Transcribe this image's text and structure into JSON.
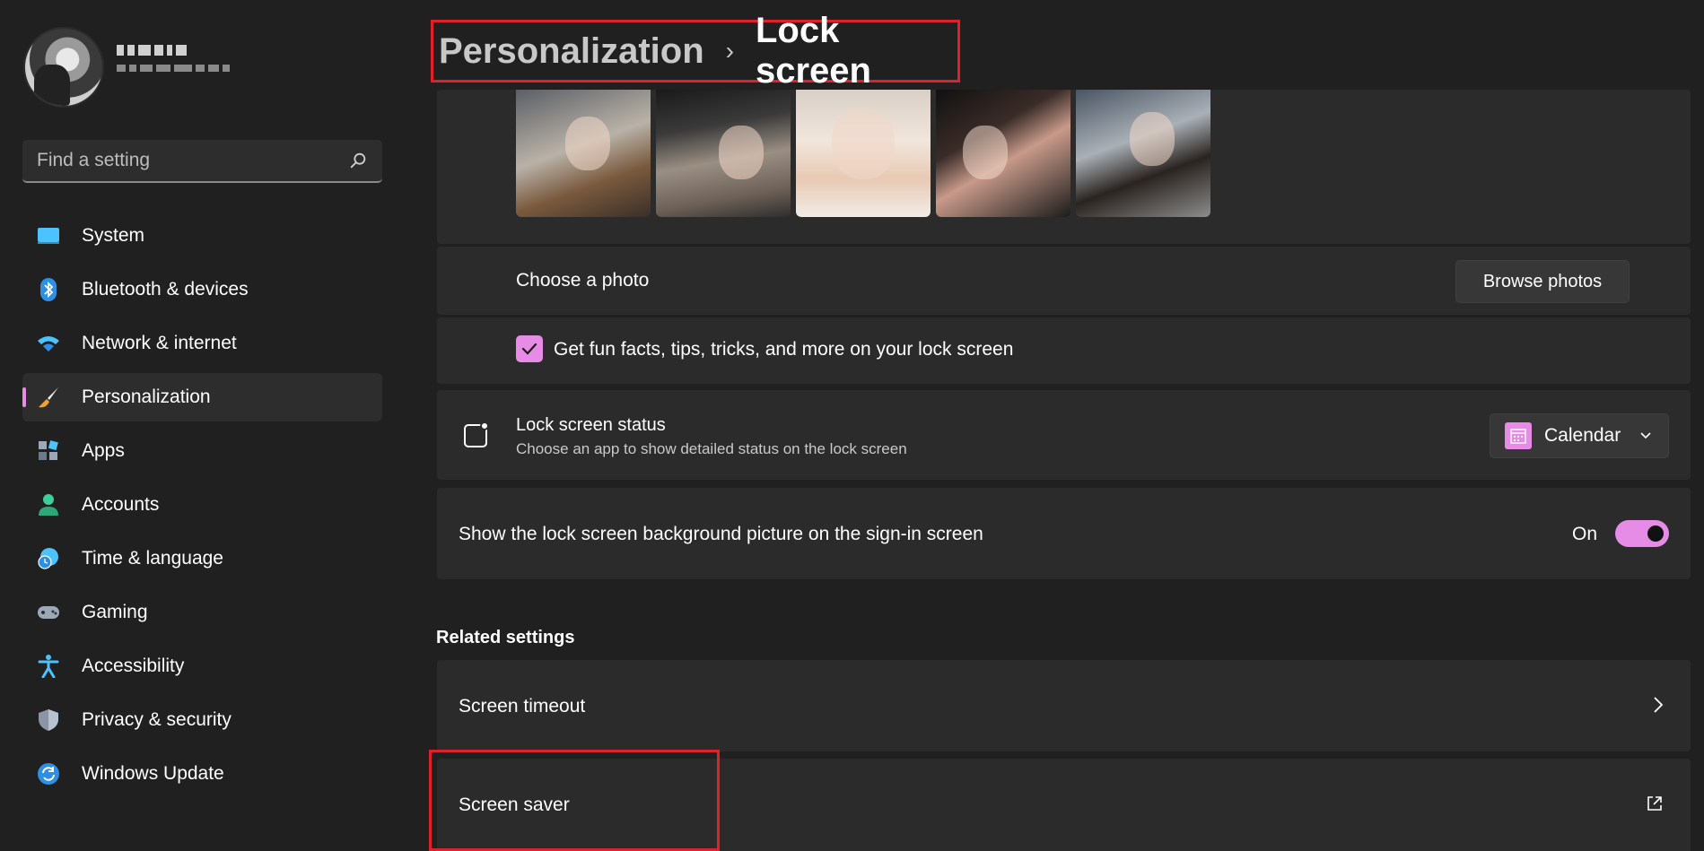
{
  "search": {
    "placeholder": "Find a setting"
  },
  "sidebar": {
    "items": [
      {
        "label": "System",
        "icon": "system-icon"
      },
      {
        "label": "Bluetooth & devices",
        "icon": "bluetooth-icon"
      },
      {
        "label": "Network & internet",
        "icon": "wifi-icon"
      },
      {
        "label": "Personalization",
        "icon": "brush-icon",
        "active": true
      },
      {
        "label": "Apps",
        "icon": "apps-icon"
      },
      {
        "label": "Accounts",
        "icon": "accounts-icon"
      },
      {
        "label": "Time & language",
        "icon": "time-language-icon"
      },
      {
        "label": "Gaming",
        "icon": "gaming-icon"
      },
      {
        "label": "Accessibility",
        "icon": "accessibility-icon"
      },
      {
        "label": "Privacy & security",
        "icon": "shield-icon"
      },
      {
        "label": "Windows Update",
        "icon": "update-icon"
      }
    ]
  },
  "header": {
    "parent": "Personalization",
    "separator": "›",
    "current": "Lock screen"
  },
  "main": {
    "choose_photo_label": "Choose a photo",
    "browse_photos_label": "Browse photos",
    "fun_facts_label": "Get fun facts, tips, tricks, and more on your lock screen",
    "fun_facts_checked": true,
    "lock_status_title": "Lock screen status",
    "lock_status_subtitle": "Choose an app to show detailed status on the lock screen",
    "lock_status_value": "Calendar",
    "signin_label": "Show the lock screen background picture on the sign-in screen",
    "signin_toggle_state": "On",
    "related_title": "Related settings",
    "screen_timeout_label": "Screen timeout",
    "screen_saver_label": "Screen saver"
  },
  "colors": {
    "accent": "#e68ce6",
    "highlight_box": "#e0202a",
    "background": "#202020",
    "card": "#2b2b2b"
  }
}
